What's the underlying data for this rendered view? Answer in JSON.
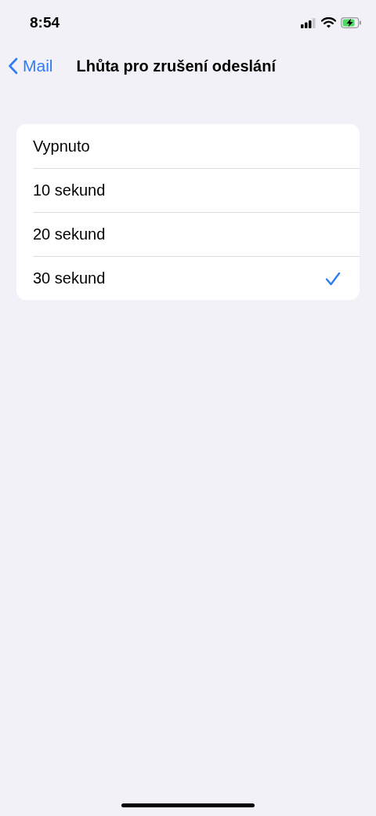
{
  "status_bar": {
    "time": "8:54"
  },
  "nav": {
    "back": "Mail",
    "title": "Lhůta pro zrušení odeslání"
  },
  "options": [
    {
      "label": "Vypnuto",
      "selected": false
    },
    {
      "label": "10 sekund",
      "selected": false
    },
    {
      "label": "20 sekund",
      "selected": false
    },
    {
      "label": "30 sekund",
      "selected": true
    }
  ]
}
